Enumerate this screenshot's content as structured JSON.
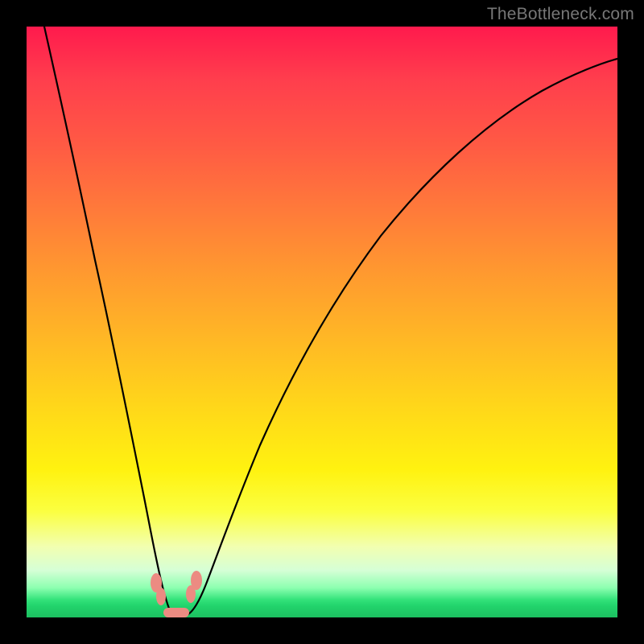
{
  "watermark": "TheBottleneck.com",
  "colors": {
    "frame": "#000000",
    "gradient_top": "#ff1a4d",
    "gradient_mid": "#fff210",
    "gradient_bottom": "#1cc060",
    "curve": "#000000",
    "marker": "#ec8b82"
  },
  "chart_data": {
    "type": "line",
    "title": "",
    "xlabel": "",
    "ylabel": "",
    "xlim": [
      0,
      100
    ],
    "ylim": [
      0,
      100
    ],
    "background_gradient": "vertical red-yellow-green (green at bottom)",
    "series": [
      {
        "name": "bottleneck-curve",
        "x": [
          3,
          5,
          8,
          11,
          14,
          17,
          19,
          21,
          22.5,
          24,
          25.5,
          27,
          30,
          34,
          40,
          48,
          58,
          70,
          84,
          98
        ],
        "y": [
          100,
          84,
          66,
          50,
          36,
          22,
          12,
          6,
          2,
          0.3,
          0.3,
          2,
          6,
          14,
          27,
          42,
          58,
          72,
          83,
          90
        ]
      }
    ],
    "annotations": [
      {
        "name": "valley-left-marker",
        "x": 22.5,
        "y": 7
      },
      {
        "name": "valley-right-marker",
        "x": 28.0,
        "y": 7
      },
      {
        "name": "valley-floor-marker",
        "x": 25.0,
        "y": 0.5
      }
    ],
    "notes": "No axis ticks or labels are rendered; chart is purely a colored field with a V-shaped curve and small salmon markers near the valley."
  }
}
